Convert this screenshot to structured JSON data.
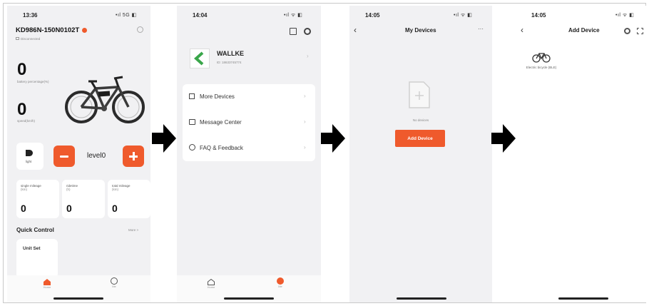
{
  "colors": {
    "accent": "#ef5a2c",
    "screen_bg": "#f1f1f3",
    "card_bg": "#ffffff"
  },
  "screen1": {
    "time": "13:36",
    "status": "•ıl 5G ◧",
    "device_name": "KD986N-150N0102T",
    "connection": "Disconnected",
    "battery_value": "0",
    "battery_label": "battery percentage(%)",
    "speed_value": "0",
    "speed_label": "speed(km/h)",
    "light_label": "light",
    "level_label": "level0",
    "stats": [
      {
        "label": "single mileage",
        "unit": "(km)",
        "value": "0"
      },
      {
        "label": "ridetime",
        "unit": "(h)",
        "value": "0"
      },
      {
        "label": "total mileage",
        "unit": "(km)",
        "value": "0"
      }
    ],
    "quick_control_title": "Quick Control",
    "more_label": "More >",
    "unit_set_label": "Unit Set",
    "nav": [
      {
        "label": "Home",
        "icon": "home-icon"
      },
      {
        "label": "Me",
        "icon": "user-icon"
      }
    ]
  },
  "screen2": {
    "time": "14:04",
    "status": "•ıl ᯤ ◧",
    "brand_name": "WALLKE",
    "brand_id": "ID: 18633745774",
    "menu": [
      {
        "label": "More Devices",
        "icon": "device-list-icon"
      },
      {
        "label": "Message Center",
        "icon": "message-icon"
      },
      {
        "label": "FAQ & Feedback",
        "icon": "help-icon"
      }
    ],
    "nav": [
      {
        "label": "Home",
        "icon": "home-icon"
      },
      {
        "label": "Me",
        "icon": "user-icon"
      }
    ]
  },
  "screen3": {
    "time": "14:05",
    "status": "•ıl ᯤ ◧",
    "title": "My Devices",
    "more_label": "···",
    "empty_label": "No devices",
    "add_button": "Add Device"
  },
  "screen4": {
    "time": "14:05",
    "status": "•ıl ᯤ ◧",
    "title": "Add Device",
    "device_label": "Electric bicycle (BLE)"
  }
}
